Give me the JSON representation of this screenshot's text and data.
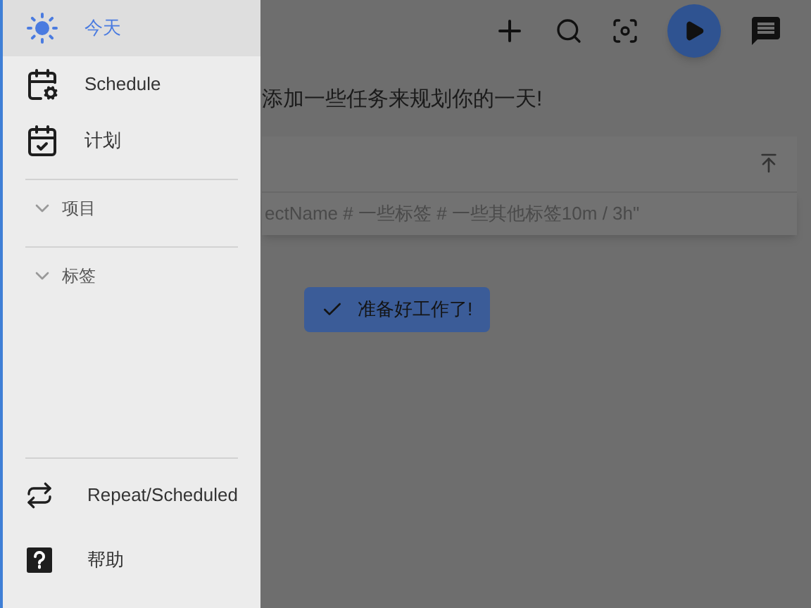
{
  "drawer": {
    "nav": [
      {
        "label": "今天",
        "selected": true
      },
      {
        "label": "Schedule",
        "selected": false
      },
      {
        "label": "计划",
        "selected": false
      }
    ],
    "sections": [
      {
        "label": "项目",
        "expanded": false
      },
      {
        "label": "标签",
        "expanded": false
      }
    ],
    "bottom_nav": [
      {
        "label": "Repeat/Scheduled"
      },
      {
        "label": "帮助"
      }
    ]
  },
  "main": {
    "message": "添加一些任务来规划你的一天!",
    "task_input": {
      "placeholder": "ectName # 一些标签 # 一些其他标签10m / 3h\""
    },
    "ready_button": "准备好工作了!"
  }
}
